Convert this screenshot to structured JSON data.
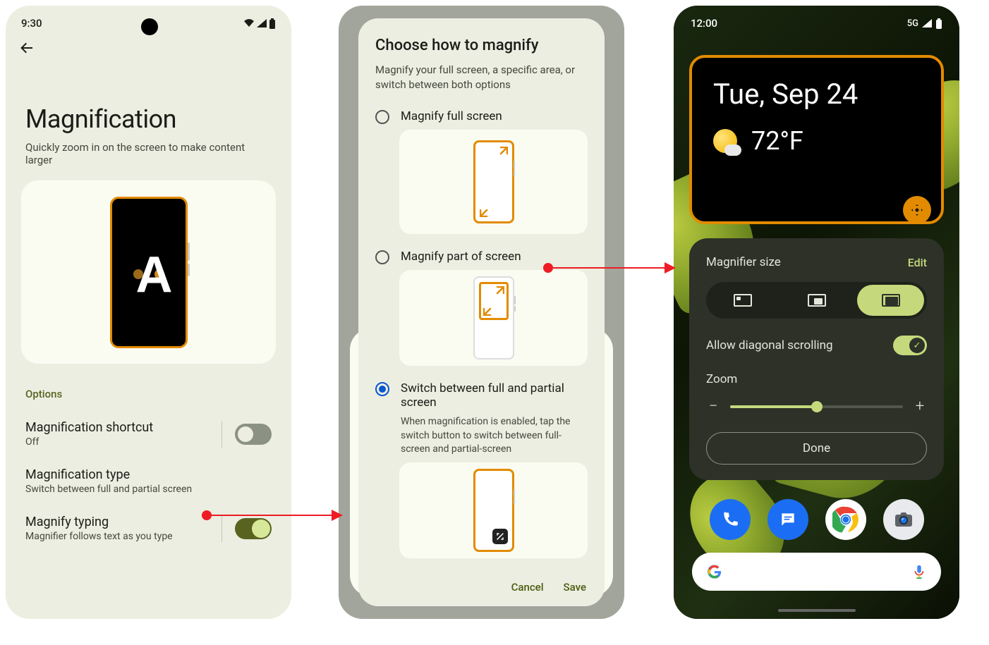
{
  "screen1": {
    "status_time": "9:30",
    "title": "Magnification",
    "subtitle": "Quickly zoom in on the screen to make content larger",
    "options_header": "Options",
    "rows": [
      {
        "title": "Magnification shortcut",
        "sub": "Off",
        "toggle": "off"
      },
      {
        "title": "Magnification type",
        "sub": "Switch between full and partial screen"
      },
      {
        "title": "Magnify typing",
        "sub": "Magnifier follows text as you type",
        "toggle": "on"
      }
    ]
  },
  "screen2": {
    "title": "Choose how to magnify",
    "subtitle": "Magnify your full screen, a specific area, or switch between both options",
    "opt1": "Magnify full screen",
    "opt2": "Magnify part of screen",
    "opt3": "Switch between full and partial screen",
    "opt3_desc": "When magnification is enabled, tap the switch button to switch between full-screen and partial-screen",
    "cancel": "Cancel",
    "save": "Save"
  },
  "screen3": {
    "status_time": "12:00",
    "status_net": "5G",
    "date": "Tue, Sep 24",
    "temp": "72°F",
    "size_label": "Magnifier size",
    "edit": "Edit",
    "diag": "Allow diagonal scrolling",
    "zoom_label": "Zoom",
    "done": "Done"
  }
}
